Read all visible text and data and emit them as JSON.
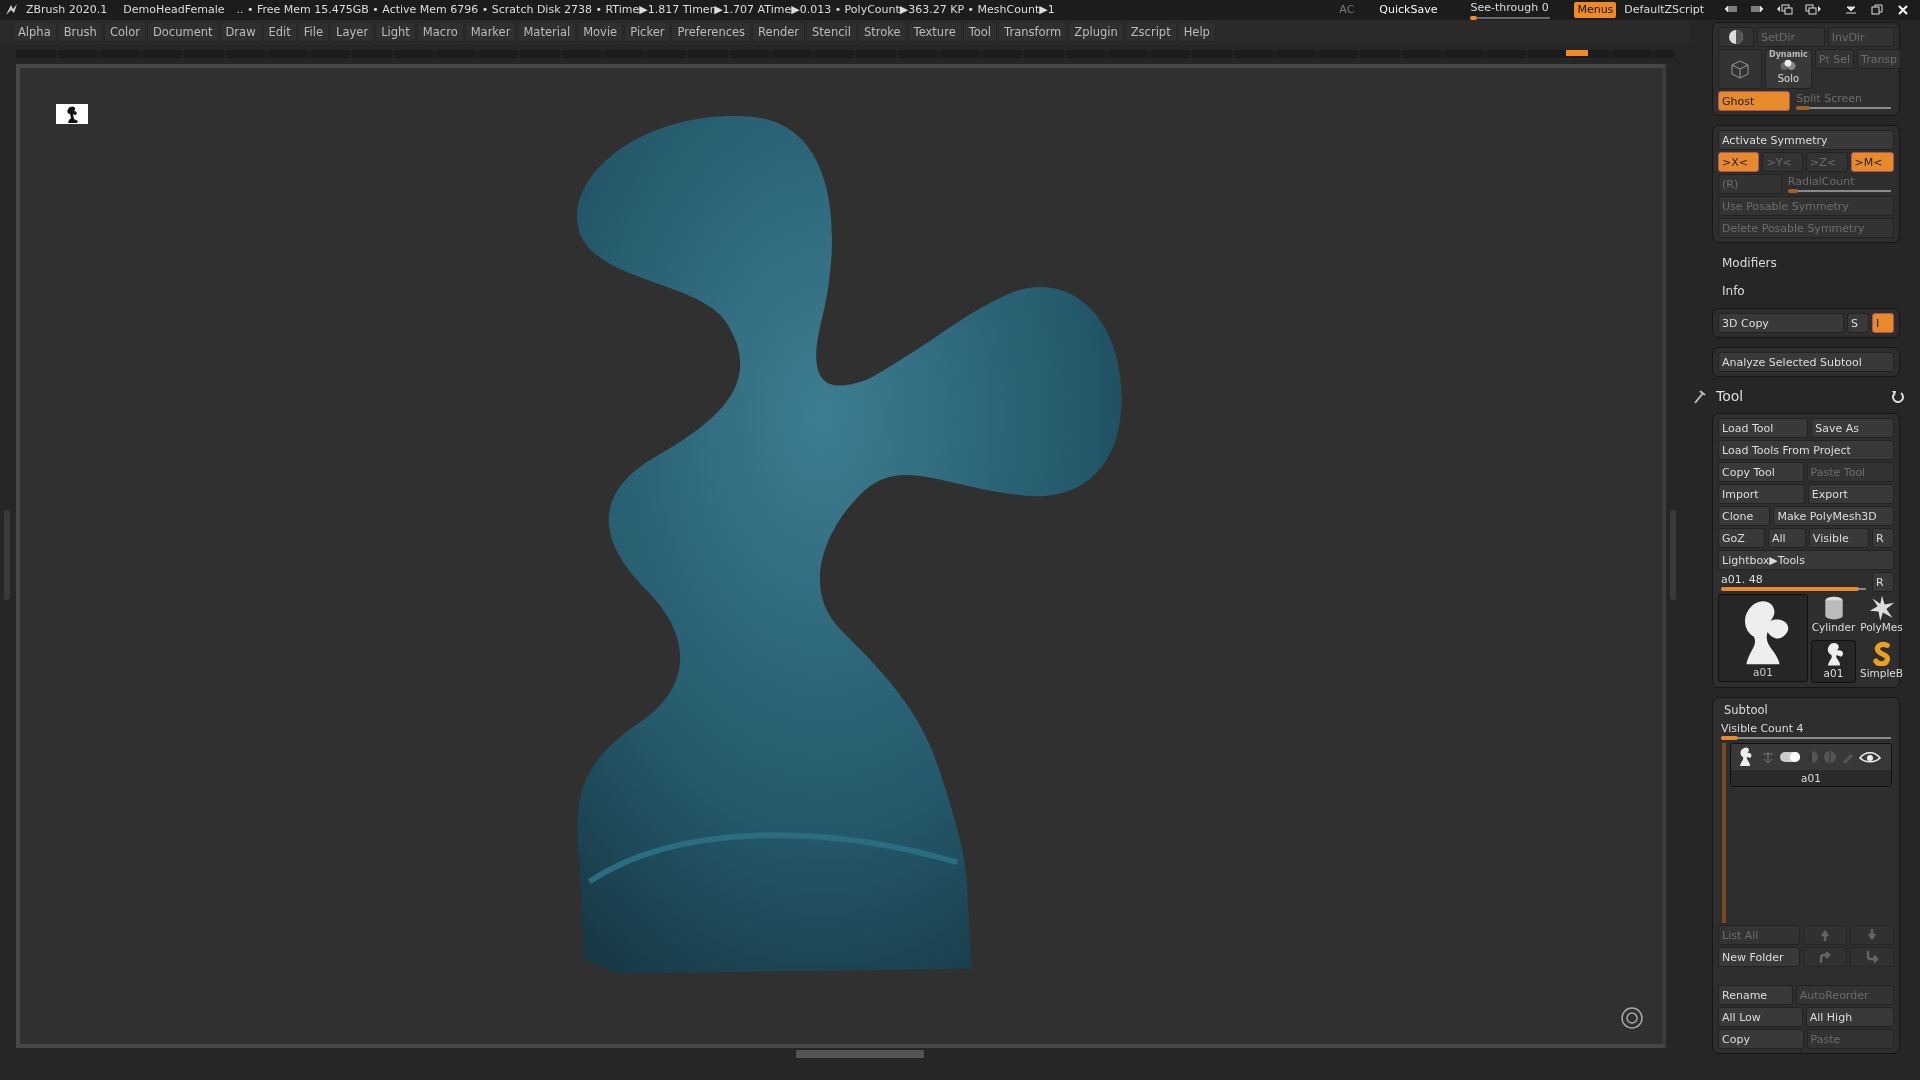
{
  "title_bar": {
    "app": "ZBrush 2020.1",
    "document": "DemoHeadFemale",
    "stats": ".. • Free Mem 15.475GB • Active Mem 6796 • Scratch Disk 2738 •  RTime▶1.817 Timer▶1.707 ATime▶0.013 • PolyCount▶363.27 KP  • MeshCount▶1",
    "ac": "AC",
    "quicksave": "QuickSave",
    "see_through": {
      "label": "See-through",
      "value": "0",
      "level": 0.08
    },
    "menus": {
      "label": "Menus",
      "on": true
    },
    "script": "DefaultZScript"
  },
  "menu_bar": [
    "Alpha",
    "Brush",
    "Color",
    "Document",
    "Draw",
    "Edit",
    "File",
    "Layer",
    "Light",
    "Macro",
    "Marker",
    "Material",
    "Movie",
    "Picker",
    "Preferences",
    "Render",
    "Stencil",
    "Stroke",
    "Texture",
    "Tool",
    "Transform",
    "Zplugin",
    "Zscript",
    "Help"
  ],
  "panel": {
    "sections": [
      {
        "kind": "group",
        "rows": [
          [
            {
              "kind": "icon",
              "disabled": false
            },
            {
              "kind": "button",
              "label": "SetDir",
              "disabled": true,
              "on": false
            },
            {
              "kind": "button",
              "label": "InvDir",
              "disabled": true,
              "on": false
            }
          ],
          [
            {
              "kind": "icon",
              "disabled": false
            },
            {
              "kind": "button",
              "label": "Solo",
              "caption": "Dynamic",
              "disabled": false,
              "on": false
            },
            {
              "kind": "button",
              "label": "Pt Sel",
              "disabled": true,
              "on": false
            },
            {
              "kind": "button",
              "label": "Transp",
              "disabled": true,
              "on": false
            }
          ],
          [
            {
              "kind": "button",
              "label": "Ghost",
              "disabled": false,
              "on": true
            },
            {
              "kind": "slider",
              "label": "Split Screen",
              "disabled": true,
              "level": 0.15
            }
          ]
        ]
      },
      {
        "kind": "group",
        "rows": [
          [
            {
              "kind": "button",
              "label": "Activate Symmetry",
              "disabled": false,
              "on": false
            }
          ],
          [
            {
              "kind": "button",
              "label": ">X<",
              "disabled": false,
              "on": true
            },
            {
              "kind": "button",
              "label": ">Y<",
              "disabled": true,
              "on": false
            },
            {
              "kind": "button",
              "label": ">Z<",
              "disabled": true,
              "on": false
            },
            {
              "kind": "button",
              "label": ">M<",
              "disabled": false,
              "on": true
            }
          ],
          [
            {
              "kind": "button",
              "label": "(R)",
              "disabled": true,
              "on": false
            },
            {
              "kind": "slider",
              "label": "RadialCount",
              "disabled": true,
              "level": 0.1
            }
          ],
          [
            {
              "kind": "button",
              "label": "Use Posable Symmetry",
              "disabled": true,
              "on": false
            }
          ],
          [
            {
              "kind": "button",
              "label": "Delete Posable Symmetry",
              "disabled": true,
              "on": false
            }
          ]
        ]
      },
      {
        "kind": "heading",
        "label": "Modifiers"
      },
      {
        "kind": "heading",
        "label": "Info"
      },
      {
        "kind": "group",
        "rows": [
          [
            {
              "kind": "button",
              "label": "3D Copy",
              "disabled": false,
              "on": false
            },
            {
              "kind": "button",
              "label": "S",
              "disabled": false,
              "on": false
            },
            {
              "kind": "button",
              "label": "I",
              "disabled": false,
              "on": true
            }
          ]
        ]
      },
      {
        "kind": "group",
        "rows": [
          [
            {
              "kind": "button",
              "label": "Analyze Selected Subtool",
              "disabled": false,
              "on": false
            }
          ]
        ]
      },
      {
        "kind": "tool_header",
        "label": "Tool"
      },
      {
        "kind": "group",
        "rows": [
          [
            {
              "kind": "button",
              "label": "Load Tool",
              "disabled": false,
              "on": false
            },
            {
              "kind": "button",
              "label": "Save As",
              "disabled": false,
              "on": false
            }
          ],
          [
            {
              "kind": "button",
              "label": "Load Tools From Project",
              "disabled": false,
              "on": false
            }
          ],
          [
            {
              "kind": "button",
              "label": "Copy Tool",
              "disabled": false,
              "on": false
            },
            {
              "kind": "button",
              "label": "Paste Tool",
              "disabled": true,
              "on": false
            }
          ],
          [
            {
              "kind": "button",
              "label": "Import",
              "disabled": false,
              "on": false
            },
            {
              "kind": "button",
              "label": "Export",
              "disabled": false,
              "on": false
            }
          ],
          [
            {
              "kind": "button",
              "label": "Clone",
              "disabled": false,
              "on": false
            },
            {
              "kind": "button",
              "label": "Make PolyMesh3D",
              "disabled": false,
              "on": false
            }
          ],
          [
            {
              "kind": "button",
              "label": "GoZ",
              "disabled": false,
              "on": false
            },
            {
              "kind": "button",
              "label": "All",
              "disabled": false,
              "on": false
            },
            {
              "kind": "button",
              "label": "Visible",
              "disabled": false,
              "on": false
            },
            {
              "kind": "button",
              "label": "R",
              "disabled": false,
              "on": false
            }
          ],
          [
            {
              "kind": "button",
              "label": "Lightbox▶Tools",
              "disabled": false,
              "on": false
            }
          ],
          [
            {
              "kind": "slider",
              "label": "a01. 48",
              "disabled": false,
              "level": 0.95,
              "side_button": "R"
            }
          ],
          [
            {
              "kind": "thumbs",
              "items": [
                {
                  "label": "a01",
                  "selected": true
                },
                {
                  "label": "Cylinder",
                  "selected": false
                },
                {
                  "label": "PolyMes",
                  "selected": false
                },
                {
                  "label": "a01",
                  "selected": true
                },
                {
                  "label": "SimpleB",
                  "selected": false
                }
              ]
            }
          ]
        ]
      },
      {
        "kind": "group",
        "title": "Subtool",
        "rows": [
          [
            {
              "kind": "slider",
              "label": "Visible Count 4",
              "disabled": false,
              "level": 0.1
            }
          ],
          [
            {
              "kind": "subtools",
              "items": [
                {
                  "label": "a01",
                  "selected": true
                }
              ]
            }
          ],
          [
            {
              "kind": "button",
              "label": "List All",
              "disabled": true,
              "on": false
            },
            {
              "kind": "icon",
              "disabled": true
            },
            {
              "kind": "icon",
              "disabled": true
            }
          ],
          [
            {
              "kind": "button",
              "label": "New Folder",
              "disabled": false,
              "on": false
            },
            {
              "kind": "icon",
              "disabled": true
            },
            {
              "kind": "icon",
              "disabled": true
            }
          ],
          [
            {
              "kind": "spacer"
            }
          ],
          [
            {
              "kind": "button",
              "label": "Rename",
              "disabled": false,
              "on": false
            },
            {
              "kind": "button",
              "label": "AutoReorder",
              "disabled": true,
              "on": false
            }
          ],
          [
            {
              "kind": "button",
              "label": "All Low",
              "disabled": false,
              "on": false
            },
            {
              "kind": "button",
              "label": "All High",
              "disabled": false,
              "on": false
            }
          ],
          [
            {
              "kind": "button",
              "label": "Copy",
              "disabled": false,
              "on": false
            },
            {
              "kind": "button",
              "label": "Paste",
              "disabled": true,
              "on": false
            }
          ]
        ]
      }
    ]
  }
}
